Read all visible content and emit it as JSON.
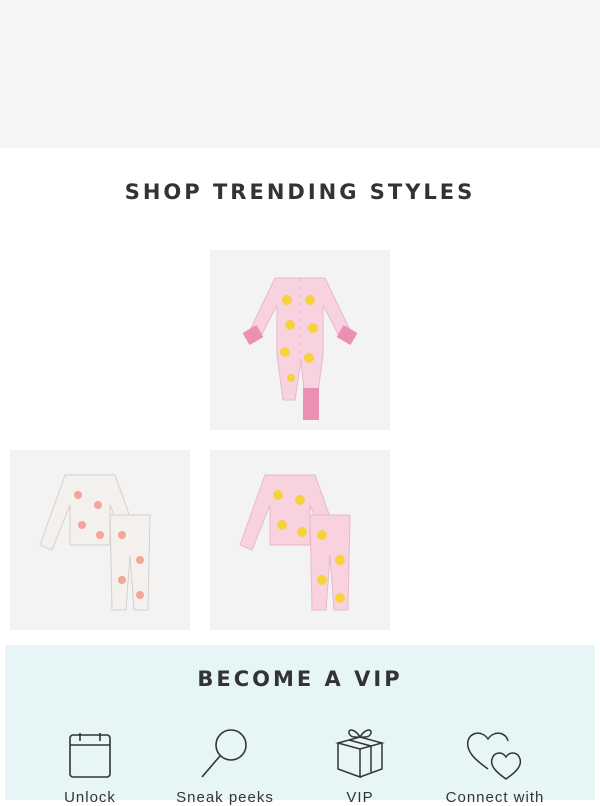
{
  "trending": {
    "title": "SHOP TRENDING STYLES",
    "products": [
      {
        "name": "pink-chick-print-footie"
      },
      {
        "name": "floral-print-pajama-set"
      },
      {
        "name": "pink-chick-print-pajama-set"
      }
    ]
  },
  "vip": {
    "title": "BECOME A VIP",
    "perks": [
      {
        "label": "Unlock",
        "icon": "calendar-icon"
      },
      {
        "label": "Sneak peeks",
        "icon": "magnifier-icon"
      },
      {
        "label": "VIP",
        "icon": "gift-icon"
      },
      {
        "label": "Connect with",
        "icon": "hearts-icon"
      }
    ]
  },
  "colors": {
    "banner": "#f6f6f6",
    "vip_bg": "#e6f6f7",
    "pink": "#f3a6c4",
    "cuff": "#ec8fb4"
  }
}
